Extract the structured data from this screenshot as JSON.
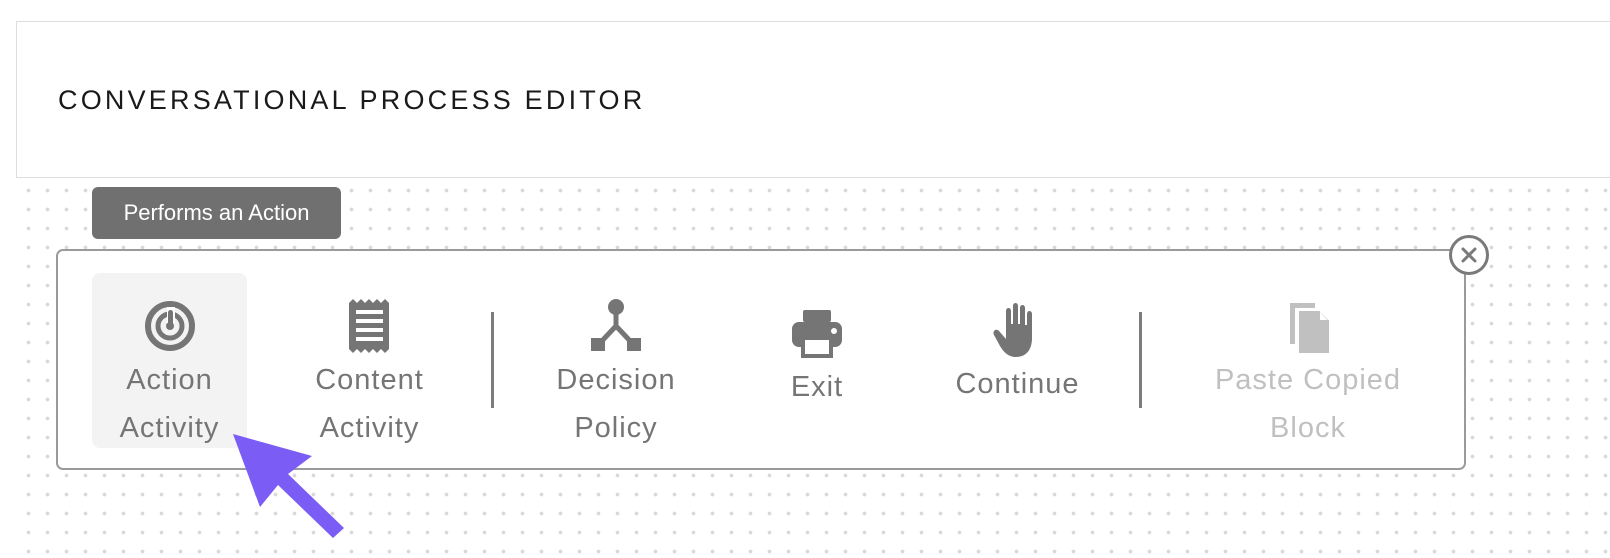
{
  "header": {
    "title": "CONVERSATIONAL PROCESS EDITOR"
  },
  "tooltip": {
    "text": "Performs an Action"
  },
  "toolbar": {
    "items": [
      {
        "id": "action-activity",
        "label_line1": "Action",
        "label_line2": "Activity",
        "icon": "target-icon",
        "state": "selected"
      },
      {
        "id": "content-activity",
        "label_line1": "Content",
        "label_line2": "Activity",
        "icon": "document-icon",
        "state": "normal"
      },
      {
        "id": "decision-policy",
        "label_line1": "Decision",
        "label_line2": "Policy",
        "icon": "branch-icon",
        "state": "normal"
      },
      {
        "id": "exit",
        "label_line1": "Exit",
        "label_line2": "",
        "icon": "printer-icon",
        "state": "normal"
      },
      {
        "id": "continue",
        "label_line1": "Continue",
        "label_line2": "",
        "icon": "hand-icon",
        "state": "normal"
      },
      {
        "id": "paste-copied-block",
        "label_line1": "Paste Copied",
        "label_line2": "Block",
        "icon": "paste-icon",
        "state": "disabled"
      }
    ]
  },
  "colors": {
    "tooltip_background": "#707070",
    "toolbar_border": "#9a9a9a",
    "icon_gray": "#757575",
    "disabled_gray": "#c0c0c0",
    "selection_background": "#f3f3f3",
    "cursor_purple": "#7b5cf5"
  },
  "close_icon": "close-circle-icon",
  "cursor_icon": "cursor-arrow-icon"
}
